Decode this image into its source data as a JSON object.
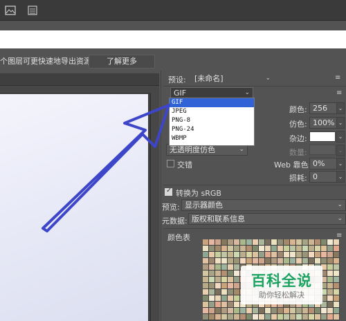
{
  "top": {
    "info_text": "个图层可更快速地导出资源",
    "learn_more": "了解更多"
  },
  "panel": {
    "preset_label": "预设:",
    "preset_value": "[未命名]",
    "format_value": "GIF",
    "format_options": [
      "GIF",
      "JPEG",
      "PNG-8",
      "PNG-24",
      "WBMP"
    ],
    "colors_label": "颜色:",
    "colors_value": "256",
    "dither_label": "仿色:",
    "dither_value": "100%",
    "matte_label": "杂边:",
    "amount_label": "数量:",
    "transparency_dither": "无透明度仿色",
    "interlaced_label": "交错",
    "web_snap_label": "Web 靠色:",
    "web_snap_value": "0%",
    "lossy_label": "损耗:",
    "lossy_value": "0",
    "convert_srgb_label": "转换为 sRGB",
    "preview_label": "预览:",
    "preview_value": "显示器颜色",
    "metadata_label": "元数据:",
    "metadata_value": "版权和联系信息",
    "color_table_label": "颜色表"
  },
  "watermark": {
    "title": "百科全说",
    "subtitle": "助你轻松解决"
  },
  "colors": {
    "selection_blue": "#2f63d6",
    "arrow_blue": "#3d45c8",
    "watermark_green": "#1aa260",
    "palette": [
      "#c9a37c",
      "#e8c9a8",
      "#a9b98a",
      "#d7d6a4",
      "#8f8f77",
      "#f0dfc3",
      "#b58f72",
      "#e6b8a1",
      "#c7d09a",
      "#9fb4a0",
      "#dcc39b",
      "#a38a6b",
      "#efe6c9",
      "#7f8a6c",
      "#cfa58d",
      "#bfc6a5",
      "#e9cfae",
      "#94a08a",
      "#d9b48f",
      "#b7aa86",
      "#f3e8d4",
      "#86775f",
      "#c4b58f",
      "#aab79d",
      "#e2a98f",
      "#d3c7a2",
      "#9c9477",
      "#ebd6b7",
      "#b09c80",
      "#cad8b4",
      "#7a6e5c",
      "#e0c2a2",
      "#a7a585",
      "#f2d9c0",
      "#8ea58f",
      "#d6b9a0",
      "#bcae8c",
      "#e9e1c0",
      "#9d8770",
      "#cbb592"
    ]
  }
}
